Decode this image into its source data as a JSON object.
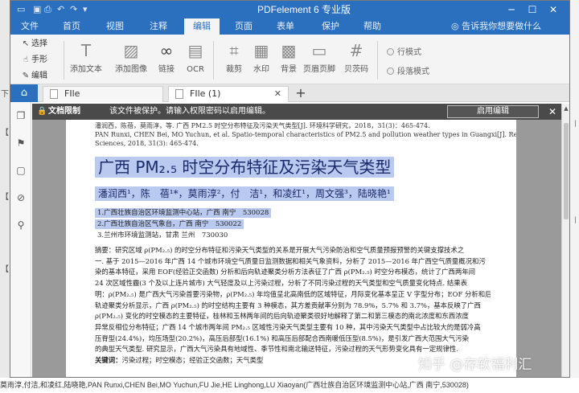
{
  "window": {
    "title": "PDFelement 6 专业版"
  },
  "menu": {
    "file": "文件",
    "tabs": [
      "首页",
      "视图",
      "注释",
      "编辑",
      "页面",
      "表单",
      "保护",
      "帮助"
    ],
    "active_tab": "编辑",
    "help_prompt": "告诉我你想要做什么"
  },
  "ribbon": {
    "select": "选择",
    "hand": "手形",
    "edit": "编辑",
    "add_text": "添加文本",
    "add_image": "添加图像",
    "link": "链接",
    "ocr": "OCR",
    "crop": "裁剪",
    "watermark": "水印",
    "background": "背景",
    "header_footer": "页眉页脚",
    "bates": "贝茨码",
    "line_mode": "行模式",
    "paragraph_mode": "段落模式"
  },
  "tabs": {
    "tab1": "FIle",
    "tab2": "FIle (1)"
  },
  "notice": {
    "label": "文档限制",
    "message": "该文件被保护。请输入权限密码以启用编辑。",
    "enable_button": "启用编辑"
  },
  "document": {
    "ref_line1": "潘润西，陈蓓，莫雨淳，等. 广西 PM2.5 时空分布特征及污染天气类型[J]. 环境科学研究，2018，31(3)：465-474.",
    "ref_line2": "PAN Runxi, CHEN Bei, MO Yuchun, et al. Spatio-temporal characteristics of PM2.5 and pollution weather types in Guangxi[J]. Research of Environmental",
    "ref_line3": "Sciences, 2018, 31(3): 465-474.",
    "title": "广西 PM₂.₅ 时空分布特征及污染天气类型",
    "authors": "潘润西¹，陈　蓓¹*，莫雨淳²，付　洁¹，和凌红¹，周文强³，陆晓艳¹",
    "affil1": "1.广西壮族自治区环境监测中心站，广西 南宁　530028",
    "affil2": "2.广西壮族自治区气象台，广西 南宁　530022",
    "affil3": "3.兰州市环境监测站，甘肃 兰州　730030",
    "abstract_lines": [
      "摘要：研究区域 ρ(PM₂.₅) 的时空分布特征和污染天气类型的关系是开展大气污染防治和空气质量预报预警的关键支撑技术之",
      "一. 基于 2015—2016 年广西 14 个城市环境空气质量日监测数据和相关气象资料，分析了 2015—2016 年广西空气质量概况和污",
      "染的基本特征，采用 EOF(经验正交函数) 分析和后向轨迹聚类分析方法表征了广西 ρ(PM₂.₅) 时空分布模态，统计了广西两年间",
      "24 次区域性霾(3 个及以上连片城市) 大气轻度及以上污染过程，分析了不同污染过程的天气类型和空气质量变化特点. 结果表",
      "明：ρ(PM₂.₅) 是广西大气污染首要污染物，ρ(PM₂.₅) 年均值呈北高南低的区域特征，月际变化基本呈正 V 字型分布；EOF 分析和后向",
      "轨迹聚类分析显示，广西 ρ(PM₂.₅) 的时空结构主要有 3 种模态，其方差贡献率分别为 78.9%，5.7% 和 3.7%，基本反映了广西",
      "ρ(PM₂.₅) 变化的时空模态的主要特征，桂林和玉林两年间的后向轨迹聚类很好地解释了第二和第三模态的南北浓度和东西浓度",
      "异常反相位分布特征；广西 14 个城市两年间 PM₂.₅ 区域性污染天气类型主要有 10 种，其中污染天气类型中占比较大的是弱冷高",
      "压脊型(24.4%)，均压场型(20.2%)，高压后部型(16.1%) 和高压后部配合西南暖低压型(8.5%)，是引发广西大范围大气污染",
      "的典型天气类型. 研究显示，广西大气污染具有地域性、季节性和南北输送特征，污染过程的天气形势变化具有一定规律性."
    ],
    "keywords_label": "关键词：",
    "keywords": "污染过程；时空模态；经验正交函数；天气类型"
  },
  "status": {
    "text": "莫雨淳,付洁,和凌红,陆晓艳,PAN Runxi,CHEN Bei,MO Yuchun,FU Jie,HE Linghong,LU Xiaoyan(广西壮族自治区环境监测中心站,广西 南宁,530028)"
  },
  "watermark": "知乎 @存软福利汇",
  "colors": {
    "titlebar": "#2b6fbf",
    "highlight": "#b9c9ef",
    "notice_bg": "#4a4a4a"
  },
  "icons": {
    "undo": "undo-icon",
    "redo": "redo-icon",
    "print": "print-icon",
    "save": "save-icon"
  }
}
